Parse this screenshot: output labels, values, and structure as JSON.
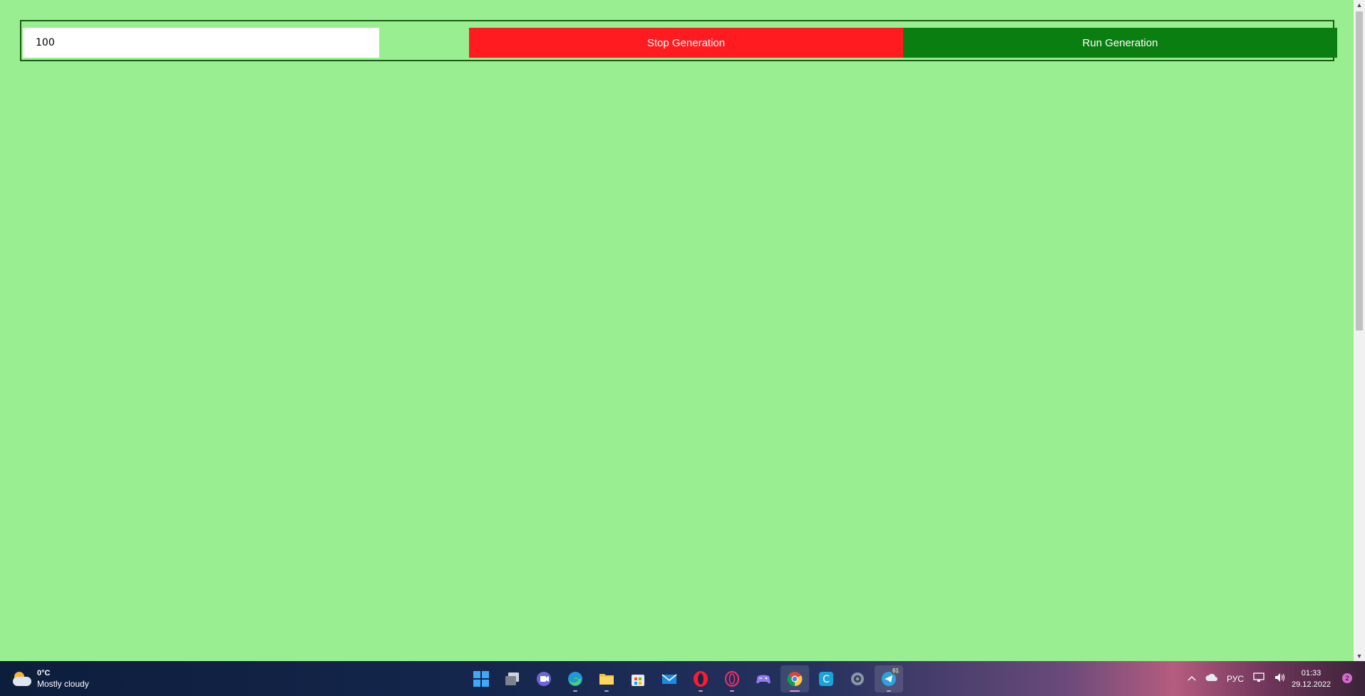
{
  "controls": {
    "count_value": "100",
    "stop_label": "Stop Generation",
    "run_label": "Run Generation",
    "stop_color": "#ff1b1f",
    "run_color": "#0b7e11"
  },
  "page": {
    "background": "#98ee90"
  },
  "taskbar": {
    "weather_temp": "0°C",
    "weather_desc": "Mostly cloudy",
    "language": "РУС",
    "time": "01:33",
    "date": "29.12.2022",
    "notification_count": "2",
    "telegram_badge": "61",
    "apps": [
      "start-icon",
      "task-view-icon",
      "chat-icon",
      "edge-icon",
      "file-explorer-icon",
      "store-icon",
      "mail-icon",
      "opera-icon",
      "opera-gx-icon",
      "game-controller-icon",
      "chrome-icon",
      "c-app-icon",
      "settings-icon",
      "telegram-icon"
    ]
  }
}
